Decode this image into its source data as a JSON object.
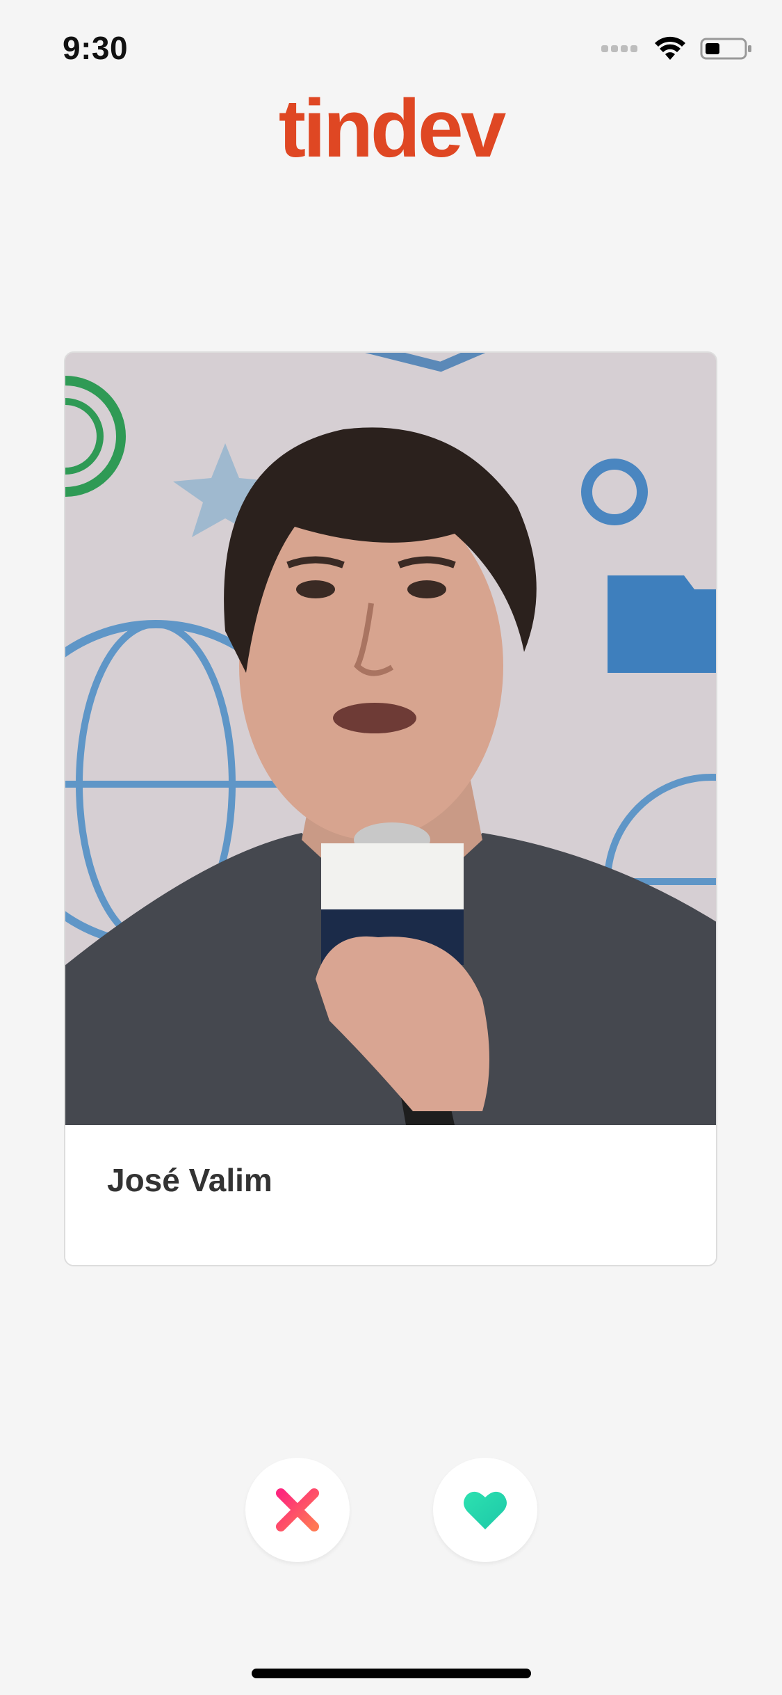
{
  "status_bar": {
    "time": "9:30"
  },
  "header": {
    "logo_text": "tindev"
  },
  "card": {
    "name": "José Valim",
    "photo_icon": "profile-photo"
  },
  "actions": {
    "dislike_icon": "close-icon",
    "like_icon": "heart-icon"
  },
  "colors": {
    "brand": "#df4723",
    "dislike": "#f04f6a",
    "like": "#2de1b0",
    "background": "#f5f5f5"
  }
}
